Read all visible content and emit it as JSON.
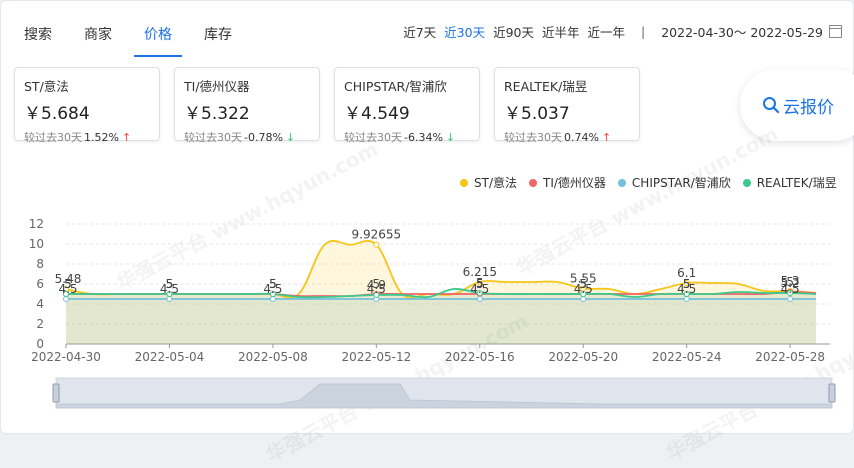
{
  "tabs": [
    "搜索",
    "商家",
    "价格",
    "库存"
  ],
  "active_tab": 2,
  "ranges": [
    "近7天",
    "近30天",
    "近90天",
    "近半年",
    "近一年"
  ],
  "active_range": 1,
  "separator": "|",
  "date_range": "2022-04-30～ 2022-05-29",
  "cards": [
    {
      "name": "ST/意法",
      "price": "￥5.684",
      "compare_label": "较过去30天",
      "pct": "1.52%",
      "trend": "up",
      "arrow": "↑"
    },
    {
      "name": "TI/德州仪器",
      "price": "￥5.322",
      "compare_label": "较过去30天",
      "pct": "-0.78%",
      "trend": "down",
      "arrow": "↓"
    },
    {
      "name": "CHIPSTAR/智浦欣",
      "price": "￥4.549",
      "compare_label": "较过去30天",
      "pct": "-6.34%",
      "trend": "down",
      "arrow": "↓"
    },
    {
      "name": "REALTEK/瑞昱",
      "price": "￥5.037",
      "compare_label": "较过去30天",
      "pct": "0.74%",
      "trend": "up",
      "arrow": "↑"
    }
  ],
  "quote_button": {
    "label": "云报价",
    "icon": "search-icon"
  },
  "watermark": "华强云平台 www.hqyun.com",
  "colors": {
    "accent": "#1a73e8",
    "up": "#f04848",
    "down": "#3cc47c"
  },
  "chart_data": {
    "type": "area",
    "x": [
      "2022-04-30",
      "2022-05-01",
      "2022-05-02",
      "2022-05-03",
      "2022-05-04",
      "2022-05-05",
      "2022-05-06",
      "2022-05-07",
      "2022-05-08",
      "2022-05-09",
      "2022-05-10",
      "2022-05-11",
      "2022-05-12",
      "2022-05-13",
      "2022-05-14",
      "2022-05-15",
      "2022-05-16",
      "2022-05-17",
      "2022-05-18",
      "2022-05-19",
      "2022-05-20",
      "2022-05-21",
      "2022-05-22",
      "2022-05-23",
      "2022-05-24",
      "2022-05-25",
      "2022-05-26",
      "2022-05-27",
      "2022-05-28",
      "2022-05-29"
    ],
    "x_tick_labels": [
      "2022-04-30",
      "2022-05-04",
      "2022-05-08",
      "2022-05-12",
      "2022-05-16",
      "2022-05-20",
      "2022-05-24",
      "2022-05-28"
    ],
    "x_tick_indices": [
      0,
      4,
      8,
      12,
      16,
      20,
      24,
      28
    ],
    "ylim": [
      0,
      12
    ],
    "y_ticks": [
      0,
      2,
      4,
      6,
      8,
      10,
      12
    ],
    "grid": true,
    "legend_position": "top-right",
    "series": [
      {
        "name": "ST/意法",
        "color": "#f5c518",
        "values": [
          5.48,
          5,
          5,
          5,
          5,
          5,
          5,
          5,
          5,
          5,
          9.92655,
          9.92655,
          9.92655,
          5,
          5,
          5,
          6.215,
          6.2,
          6.2,
          6.2,
          5.55,
          5.5,
          5.0,
          5.5,
          6.1,
          6.1,
          6.0,
          5.3,
          5.3,
          5.1
        ],
        "labels": {
          "0": "5.48",
          "4": "5",
          "8": "5",
          "12": "9.92655",
          "16": "6.215",
          "20": "5.55",
          "24": "6.1",
          "28": "5.3"
        }
      },
      {
        "name": "TI/德州仪器",
        "color": "#ee6666",
        "values": [
          5,
          5,
          5,
          5,
          5,
          5,
          5,
          5,
          5,
          4.8,
          4.8,
          4.8,
          5,
          5,
          5,
          5,
          5,
          5,
          5,
          5,
          5,
          5,
          5,
          5,
          5,
          5,
          5,
          5,
          5.2,
          5.1
        ],
        "labels": {
          "0": "5",
          "4": "5",
          "8": "5",
          "12": "5",
          "16": "5",
          "20": "5",
          "24": "5",
          "28": "5"
        }
      },
      {
        "name": "CHIPSTAR/智浦欣",
        "color": "#73c0de",
        "values": [
          4.5,
          4.5,
          4.5,
          4.5,
          4.5,
          4.5,
          4.5,
          4.5,
          4.5,
          4.5,
          4.5,
          4.5,
          4.5,
          4.5,
          4.5,
          4.5,
          4.5,
          4.5,
          4.5,
          4.5,
          4.5,
          4.5,
          4.5,
          4.5,
          4.5,
          4.5,
          4.5,
          4.5,
          4.5,
          4.5
        ],
        "labels": {
          "0": "4.5",
          "4": "4.5",
          "8": "4.5",
          "12": "4.5",
          "16": "4.5",
          "20": "4.5",
          "24": "4.5",
          "28": "4.5"
        }
      },
      {
        "name": "REALTEK/瑞昱",
        "color": "#3ac98e",
        "values": [
          5,
          5,
          5,
          5,
          5,
          5,
          5,
          5,
          5,
          4.7,
          4.7,
          4.8,
          4.9,
          4.9,
          4.7,
          5.5,
          5.1,
          5,
          5,
          5,
          5,
          5,
          4.7,
          5,
          5,
          5,
          5.2,
          5.1,
          5.1,
          5
        ],
        "labels": {
          "0": "5",
          "4": "5",
          "8": "5",
          "12": "4.9",
          "16": "5",
          "20": "5",
          "24": "5",
          "28": "5.2"
        }
      }
    ]
  }
}
